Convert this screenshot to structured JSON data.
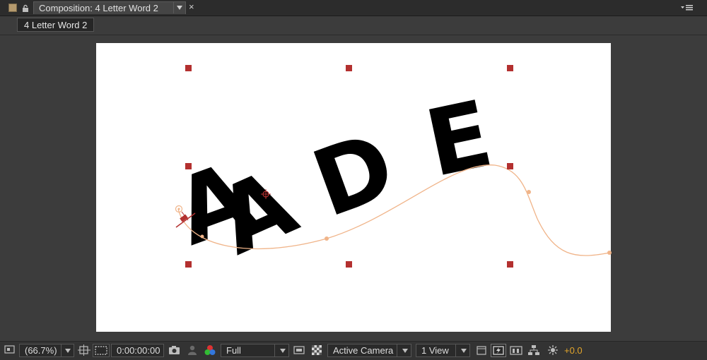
{
  "tab": {
    "title": "Composition: 4 Letter Word 2",
    "close": "×"
  },
  "breadcrumb": {
    "label": "4 Letter Word 2"
  },
  "comp": {
    "letters": [
      "A",
      "A",
      "D",
      "E"
    ],
    "background": "#ffffff",
    "handle_color": "#b3302f",
    "motion_path_color": "#f0b489",
    "letter_color": "#000000"
  },
  "toolbar": {
    "magnification": "(66.7%)",
    "timecode": "0:00:00:00",
    "resolution": "Full",
    "camera": "Active Camera",
    "views": "1 View",
    "exposure": "+0.0"
  },
  "colors": {
    "panel": "#3c3c3c",
    "tabbar": "#2c2c2c",
    "accent": "#e3a52b"
  },
  "icons": [
    "lock-icon",
    "chevron-down-icon",
    "panel-menu-icon",
    "snapshot-icon",
    "show-snapshot-icon",
    "channel-icon",
    "region-of-interest-icon",
    "transparency-grid-icon",
    "fast-preview-icon",
    "timeline-icon",
    "flowchart-icon",
    "reset-exposure-icon"
  ]
}
